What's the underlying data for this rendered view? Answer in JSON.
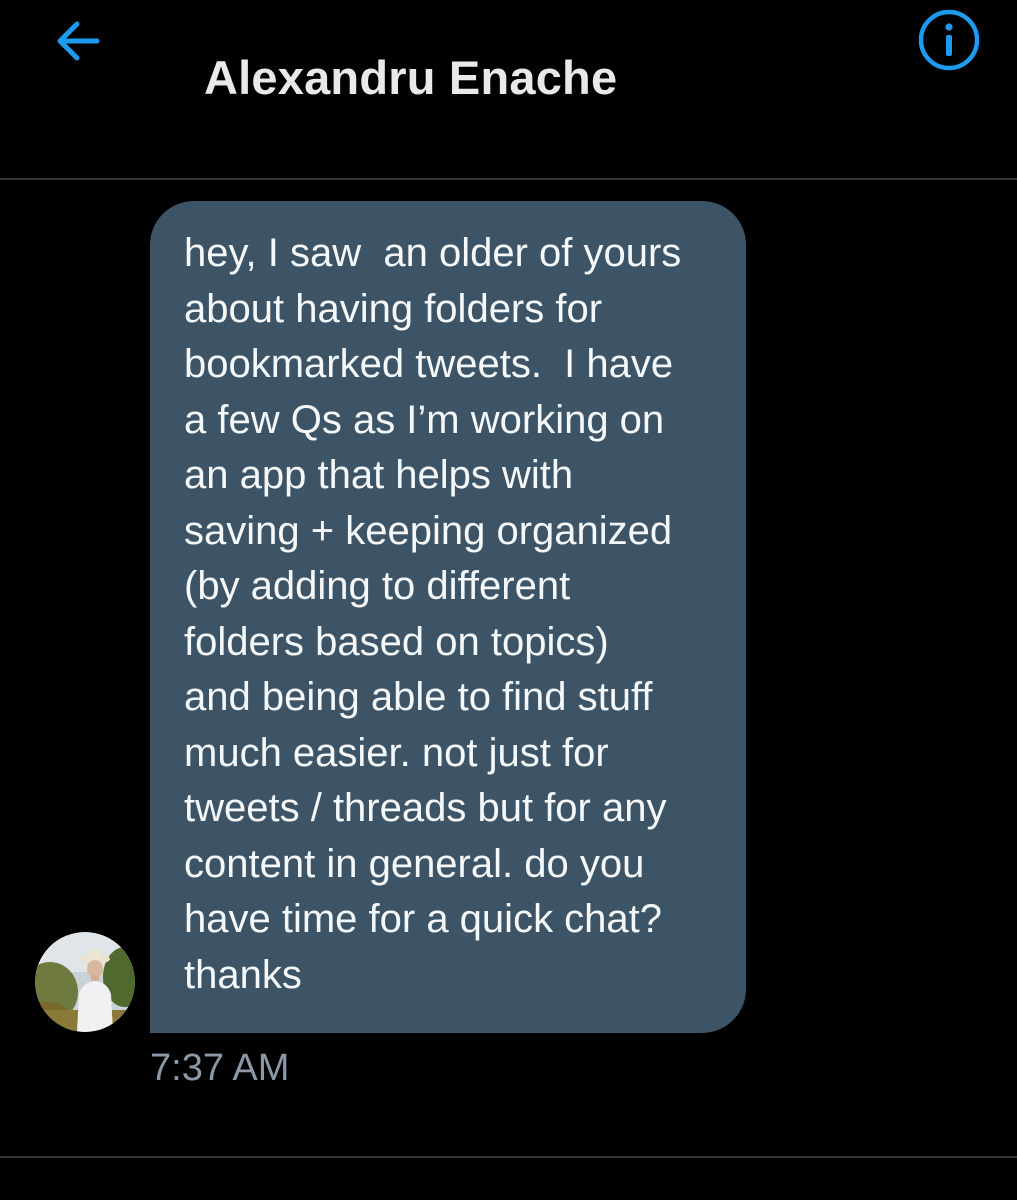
{
  "header": {
    "back_icon": "arrow-left-icon",
    "title": "Alexandru Enache",
    "info_icon": "info-circle-icon",
    "accent_color": "#1d9bf0"
  },
  "conversation": {
    "message": {
      "lines": [
        "hey, I saw  an older of yours",
        "about having folders for",
        "bookmarked tweets.  I have",
        "a few Qs as I’m working on",
        "an app that helps with",
        "saving + keeping organized",
        "(by adding to different",
        "folders based on topics)",
        "and being able to find stuff",
        "much easier. not just for",
        "tweets / threads but for any",
        "content in general. do you",
        "have time for a quick chat?",
        "thanks"
      ],
      "timestamp": "7:37 AM",
      "bubble_color": "#3d5466"
    },
    "sender_avatar": "avatar-photo"
  }
}
